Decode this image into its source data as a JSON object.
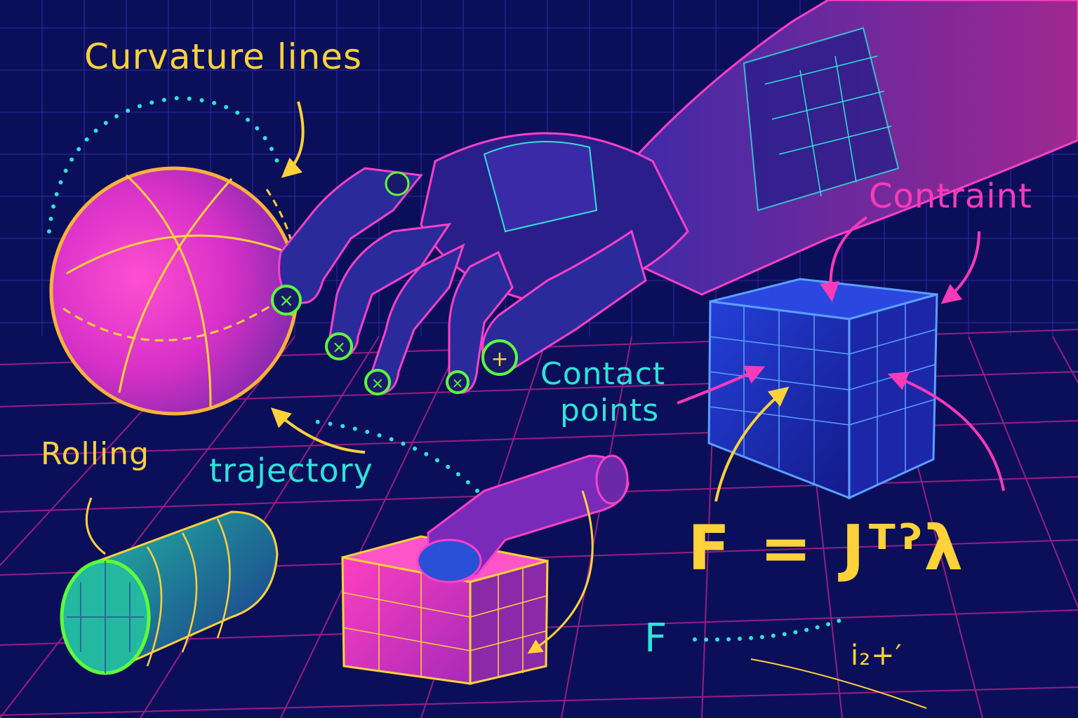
{
  "labels": {
    "curvature": "Curvature lines",
    "constraint": "Contraint",
    "contact_line1": "Contact",
    "contact_line2": "points",
    "rolling": "Rolling",
    "trajectory": "trajectory",
    "equation": "F = Jᵀˀλ",
    "equation_small": "F",
    "equation_fragment": "i₂+′"
  },
  "palette": {
    "background": "#0b0f5a",
    "grid": "#3a2fb0",
    "floor_grid": "#b0208a",
    "yellow": "#ffd23a",
    "cyan": "#2fe3d8",
    "magenta": "#ff3ab8",
    "green": "#5cff3a",
    "robot_body": "#2a1f8a",
    "robot_edge": "#ff40c8"
  }
}
